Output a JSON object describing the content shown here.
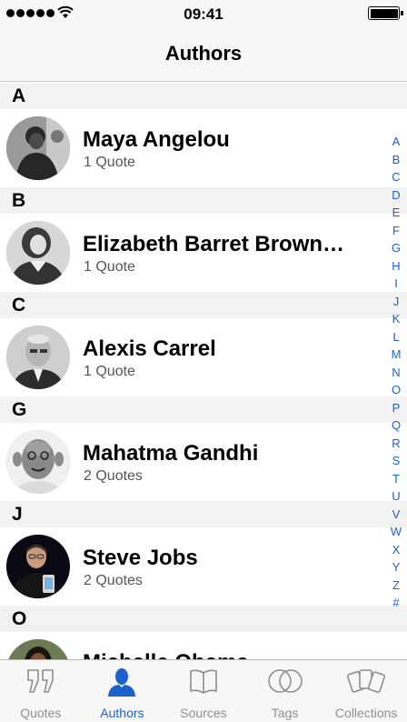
{
  "status_bar": {
    "time": "09:41"
  },
  "nav": {
    "title": "Authors"
  },
  "sections": [
    {
      "letter": "A",
      "rows": [
        {
          "name": "Maya Angelou",
          "count": "1 Quote"
        }
      ]
    },
    {
      "letter": "B",
      "rows": [
        {
          "name": "Elizabeth Barret Brown…",
          "count": "1 Quote"
        }
      ]
    },
    {
      "letter": "C",
      "rows": [
        {
          "name": "Alexis Carrel",
          "count": "1 Quote"
        }
      ]
    },
    {
      "letter": "G",
      "rows": [
        {
          "name": "Mahatma Gandhi",
          "count": "2 Quotes"
        }
      ]
    },
    {
      "letter": "J",
      "rows": [
        {
          "name": "Steve Jobs",
          "count": "2 Quotes"
        }
      ]
    },
    {
      "letter": "O",
      "rows": [
        {
          "name": "Michelle Obama",
          "count": ""
        }
      ]
    }
  ],
  "index": [
    "A",
    "B",
    "C",
    "D",
    "E",
    "F",
    "G",
    "H",
    "I",
    "J",
    "K",
    "L",
    "M",
    "N",
    "O",
    "P",
    "Q",
    "R",
    "S",
    "T",
    "U",
    "V",
    "W",
    "X",
    "Y",
    "Z",
    "#"
  ],
  "tabs": [
    {
      "label": "Quotes",
      "icon": "quote-icon",
      "active": false
    },
    {
      "label": "Authors",
      "icon": "person-icon",
      "active": true
    },
    {
      "label": "Sources",
      "icon": "book-icon",
      "active": false
    },
    {
      "label": "Tags",
      "icon": "tags-icon",
      "active": false
    },
    {
      "label": "Collections",
      "icon": "cards-icon",
      "active": false
    }
  ],
  "colors": {
    "accent": "#1a62c9",
    "section_bg": "#f2f2f2",
    "bar_bg": "#f7f7f7",
    "inactive": "#8e8e8e"
  }
}
